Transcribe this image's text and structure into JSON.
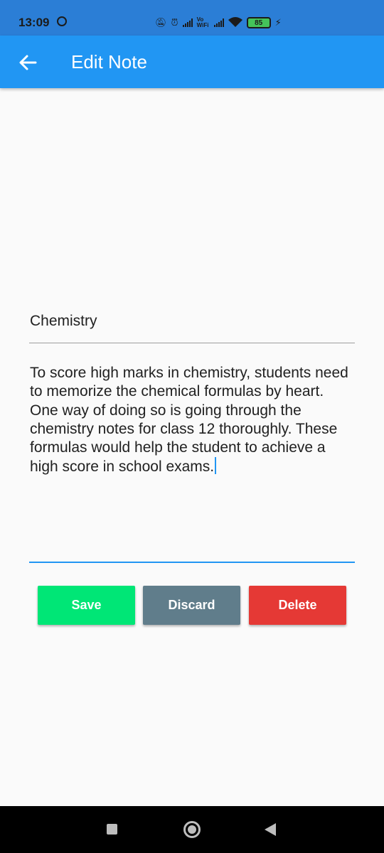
{
  "status_bar": {
    "time": "13:09",
    "battery": "85",
    "vowifi": "Vo WiFi"
  },
  "app_bar": {
    "title": "Edit Note",
    "back_icon": "arrow-left-icon",
    "background": "#2196f3"
  },
  "note": {
    "title": "Chemistry",
    "body": "To score high marks in chemistry, students need to memorize the chemical formulas by heart. One way of doing so is going through the chemistry notes for class 12 thoroughly. These formulas would help the student to achieve a high score in school exams."
  },
  "actions": {
    "save_label": "Save",
    "discard_label": "Discard",
    "delete_label": "Delete",
    "save_color": "#00e676",
    "discard_color": "#607d8b",
    "delete_color": "#e53935"
  }
}
